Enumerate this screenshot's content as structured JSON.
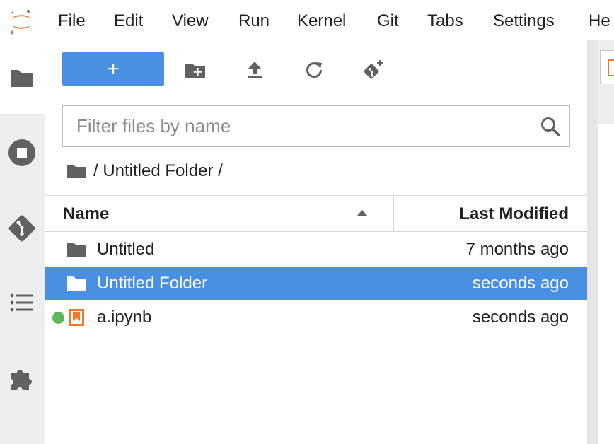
{
  "menu": {
    "items": [
      "File",
      "Edit",
      "View",
      "Run",
      "Kernel",
      "Git",
      "Tabs",
      "Settings",
      "He"
    ]
  },
  "sidebar": {
    "icons": [
      "folder-icon",
      "stop-circle-icon",
      "git-icon",
      "list-icon",
      "puzzle-icon"
    ]
  },
  "toolbar": {
    "new_label": "+"
  },
  "filter": {
    "placeholder": "Filter files by name"
  },
  "breadcrumb": {
    "path": "/ Untitled Folder /"
  },
  "columns": {
    "name": "Name",
    "modified": "Last Modified"
  },
  "files": [
    {
      "name": "Untitled",
      "modified": "7 months ago",
      "type": "folder",
      "selected": false,
      "running": false
    },
    {
      "name": "Untitled Folder",
      "modified": "seconds ago",
      "type": "folder",
      "selected": true,
      "running": false
    },
    {
      "name": "a.ipynb",
      "modified": "seconds ago",
      "type": "notebook",
      "selected": false,
      "running": true
    }
  ],
  "colors": {
    "accent": "#4a90e2",
    "jupyter_orange": "#f37726",
    "running_green": "#5cb85c",
    "icon_gray": "#616161"
  }
}
